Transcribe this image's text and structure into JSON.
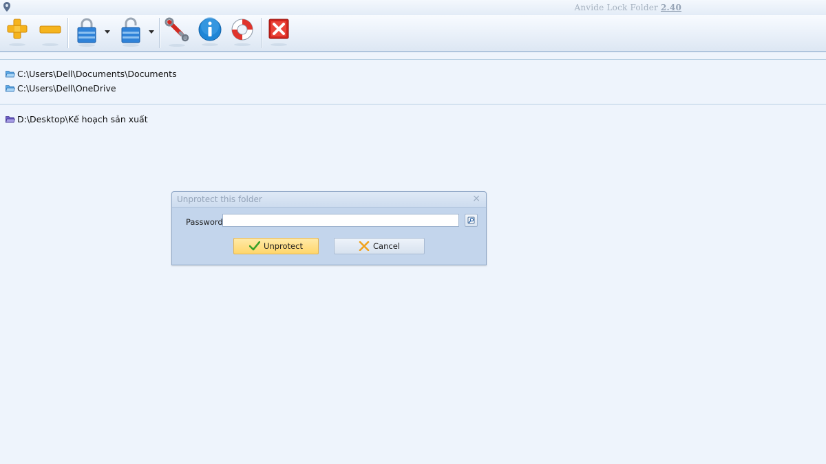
{
  "window": {
    "title": "Anvide Lock Folder",
    "version": "2.40"
  },
  "toolbar": {
    "buttons": [
      {
        "name": "add-folder",
        "icon": "plus-icon",
        "color": "#f5b41e"
      },
      {
        "name": "remove-folder",
        "icon": "minus-icon",
        "color": "#f5b41e"
      },
      {
        "name": "lock-folder",
        "icon": "padlock-closed-icon",
        "dropdown": true,
        "color": "#2f82d8"
      },
      {
        "name": "unlock-folder",
        "icon": "padlock-open-icon",
        "dropdown": true,
        "color": "#2f82d8"
      },
      {
        "name": "settings",
        "icon": "wrench-icon"
      },
      {
        "name": "about",
        "icon": "info-icon",
        "color": "#1f86d6"
      },
      {
        "name": "help",
        "icon": "lifebuoy-icon",
        "color": "#e0342c"
      },
      {
        "name": "exit",
        "icon": "close-red-icon",
        "color": "#d2231c"
      }
    ]
  },
  "folders": {
    "group1": [
      {
        "path": "C:\\Users\\Dell\\Documents\\Documents",
        "icon": "folder-open-blue-icon"
      },
      {
        "path": "C:\\Users\\Dell\\OneDrive",
        "icon": "folder-open-blue-icon"
      }
    ],
    "group2": [
      {
        "path": "D:\\Desktop\\Kế hoạch sản xuất",
        "icon": "folder-open-purple-icon"
      }
    ]
  },
  "dialog": {
    "title": "Unprotect this folder",
    "password_label": "Password",
    "password_value": "",
    "reveal_icon": "show-password-icon",
    "unprotect_label": "Unprotect",
    "cancel_label": "Cancel"
  },
  "colors": {
    "background": "#eef4fc",
    "dialog_bg": "#c3d5ec",
    "primary_button": "#ffd66b"
  }
}
